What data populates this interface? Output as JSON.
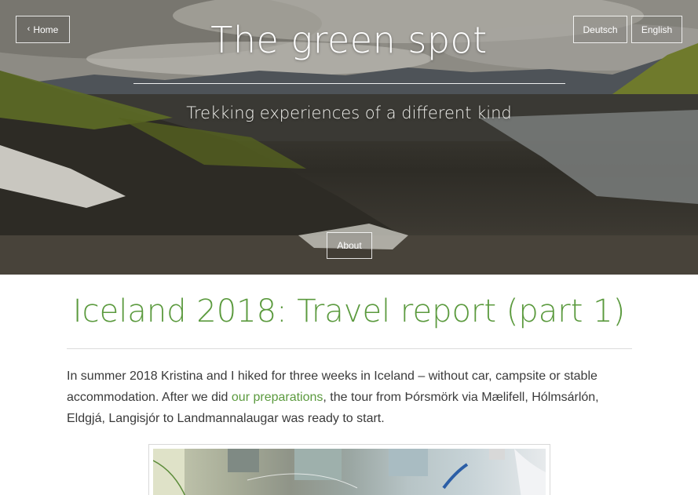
{
  "hero": {
    "home_label": "Home",
    "lang_de": "Deutsch",
    "lang_en": "English",
    "title": "The green spot",
    "subtitle": "Trekking experiences of a different kind",
    "about_label": "About"
  },
  "post": {
    "title": "Iceland 2018: Travel report (part 1)",
    "para_before_link": "In summer 2018 Kristina and I hiked for three weeks in Iceland – without car, campsite or stable accommodation. After we did ",
    "link_text": "our preparations",
    "para_after_link": ", the tour from Þórsmörk via Mælifell, Hólmsárlón, Eldgjá, Langisjór to Landmannalaugar was ready to start."
  },
  "colors": {
    "accent": "#5b9a3e",
    "body_text": "#3a3a3a",
    "rule": "#dcdcdc"
  },
  "icons": {
    "home": "chevron-left-icon"
  }
}
